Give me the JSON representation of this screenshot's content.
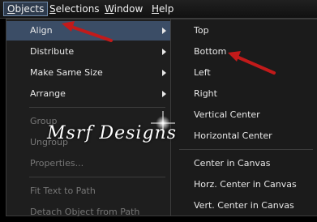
{
  "menubar": {
    "objects": {
      "u": "O",
      "rest": "bjects"
    },
    "selections": {
      "u": "S",
      "rest": "elections"
    },
    "window": {
      "u": "W",
      "rest": "indow"
    },
    "help": {
      "u": "H",
      "rest": "elp"
    }
  },
  "objects_menu": {
    "items": [
      {
        "label": "Align"
      },
      {
        "label": "Distribute"
      },
      {
        "label": "Make Same Size"
      },
      {
        "label": "Arrange"
      },
      {
        "label": "Group"
      },
      {
        "label": "Ungroup"
      },
      {
        "label": "Properties..."
      },
      {
        "label": "Fit Text to Path"
      },
      {
        "label": "Detach Object from Path"
      }
    ]
  },
  "align_submenu": {
    "items": [
      {
        "label": "Top"
      },
      {
        "label": "Bottom"
      },
      {
        "label": "Left"
      },
      {
        "label": "Right"
      },
      {
        "label": "Vertical Center"
      },
      {
        "label": "Horizontal Center"
      },
      {
        "label": "Center in Canvas"
      },
      {
        "label": "Horz. Center in Canvas"
      },
      {
        "label": "Vert. Center in Canvas"
      }
    ]
  },
  "watermark": {
    "logo_text": "Msrf Designs"
  },
  "colors": {
    "highlight": "#3b4d66",
    "pointer_arrow": "#c21a1a"
  }
}
